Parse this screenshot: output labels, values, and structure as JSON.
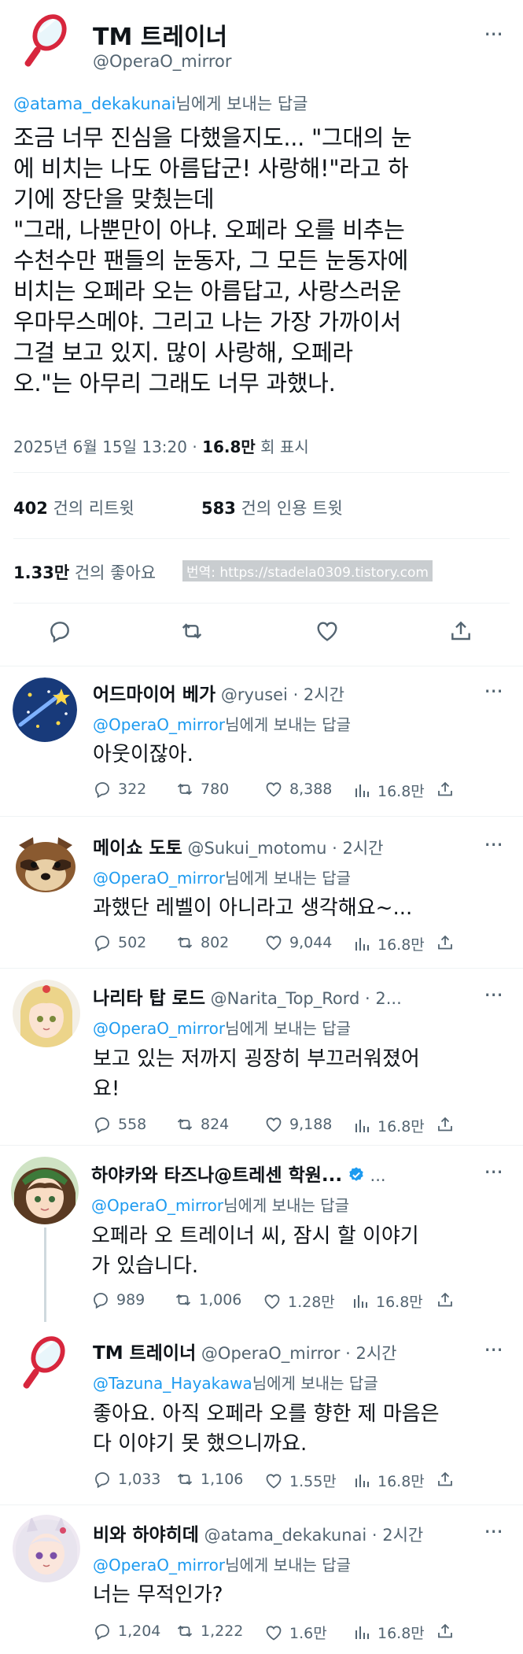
{
  "tweet": {
    "author_name": "TM 트레이너",
    "handle": "@OperaO_mirror",
    "reply_to_handle": "@atama_dekakunai",
    "reply_to_suffix": "님에게 보내는 답글",
    "body_lines": [
      "조금 너무 진심을 다했을지도... \"그대의 눈",
      "에 비치는 나도 아름답군! 사랑해!\"라고 하",
      "기에 장단을 맞췄는데",
      "\"그래, 나뿐만이 아냐. 오페라 오를 비추는",
      "수천수만 팬들의 눈동자, 그 모든 눈동자에",
      "비치는 오페라 오는 아름답고, 사랑스러운",
      "우마무스메야. 그리고 나는 가장 가까이서",
      "그걸 보고 있지. 많이 사랑해, 오페라",
      "오.\"는 아무리 그래도 너무 과했나."
    ],
    "timestamp": "2025년 6월 15일 13:20",
    "views_count": "16.8만",
    "views_label": "회 표시",
    "retweets_count": "402",
    "retweets_label": "건의 리트윗",
    "quotes_count": "583",
    "quotes_label": "건의 인용 트윗",
    "likes_count": "1.33만",
    "likes_label": "건의 좋아요",
    "watermark": "번역: https://stadela0309.tistory.com"
  },
  "replies": [
    {
      "name": "어드마이어 베가",
      "handle": "@ryusei · 2시간",
      "reply_to": "@OperaO_mirror",
      "reply_suffix": "님에게 보내는 답글",
      "lines": [
        "아웃이잖아."
      ],
      "comments": "322",
      "retweets": "780",
      "likes": "8,388",
      "views": "16.8만"
    },
    {
      "name": "메이쇼 도토",
      "handle": "@Sukui_motomu · 2시간",
      "reply_to": "@OperaO_mirror",
      "reply_suffix": "님에게 보내는 답글",
      "lines": [
        "과했단 레벨이 아니라고 생각해요~..."
      ],
      "comments": "502",
      "retweets": "802",
      "likes": "9,044",
      "views": "16.8만"
    },
    {
      "name": "나리타 탑 로드",
      "handle": "@Narita_Top_Rord · 2...",
      "reply_to": "@OperaO_mirror",
      "reply_suffix": "님에게 보내는 답글",
      "lines": [
        "보고 있는 저까지 굉장히 부끄러워졌어",
        "요!"
      ],
      "comments": "558",
      "retweets": "824",
      "likes": "9,188",
      "views": "16.8만"
    },
    {
      "name": "하야카와 타즈나@트레센 학원...",
      "handle": "",
      "reply_to": "@OperaO_mirror",
      "reply_suffix": "님에게 보내는 답글",
      "lines": [
        "오페라 오 트레이너 씨, 잠시 할 이야기",
        "가 있습니다."
      ],
      "comments": "989",
      "retweets": "1,006",
      "likes": "1.28만",
      "views": "16.8만"
    },
    {
      "name": "TM 트레이너",
      "handle": "@OperaO_mirror · 2시간",
      "reply_to": "@Tazuna_Hayakawa",
      "reply_suffix": "님에게 보내는 답글",
      "lines": [
        "좋아요. 아직 오페라 오를 향한 제 마음은",
        "다 이야기 못 했으니까요."
      ],
      "comments": "1,033",
      "retweets": "1,106",
      "likes": "1.55만",
      "views": "16.8만"
    },
    {
      "name": "비와 하야히데",
      "handle": "@atama_dekakunai · 2시간",
      "reply_to": "@OperaO_mirror",
      "reply_suffix": "님에게 보내는 답글",
      "lines": [
        "너는 무적인가?"
      ],
      "comments": "1,204",
      "retweets": "1,222",
      "likes": "1.6만",
      "views": "16.8만"
    }
  ],
  "colors": {
    "accent": "#1d9bf0",
    "text": "#0f1419",
    "muted": "#536471",
    "divider": "#eff3f4",
    "mirror_red": "#d7263d"
  }
}
